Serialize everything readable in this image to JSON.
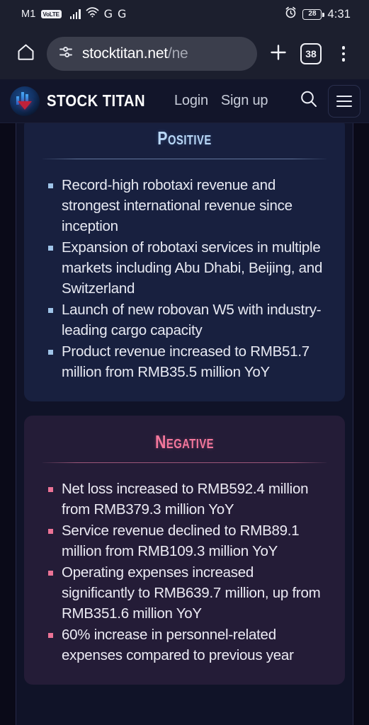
{
  "status_bar": {
    "carrier": "M1",
    "volte_badge": "VoLTE",
    "network_badges": [
      "G",
      "G"
    ],
    "battery_percent": "28",
    "time": "4:31"
  },
  "browser": {
    "home_icon": "home-icon",
    "url_main": "stocktitan.net",
    "url_truncated": "/ne",
    "site_settings_icon": "tune-icon",
    "new_tab_label": "+",
    "tab_count": "38",
    "menu_icon": "kebab-menu-icon"
  },
  "site_header": {
    "brand_name": "STOCK TITAN",
    "logo_icon": "stock-titan-logo",
    "nav": [
      {
        "label": "Login"
      },
      {
        "label": "Sign up"
      }
    ],
    "search_icon": "search-icon",
    "menu_icon": "hamburger-icon"
  },
  "main": {
    "cards": [
      {
        "id": "positive",
        "title": "Positive",
        "accent": "#b9d8f7",
        "bullet_color": "#9fc4e8",
        "background": "#18203f",
        "items": [
          "Record-high robotaxi revenue and strongest international revenue since inception",
          "Expansion of robotaxi services in multiple markets including Abu Dhabi, Beijing, and Switzerland",
          "Launch of new robovan W5 with industry-leading cargo capacity",
          "Product revenue increased to RMB51.7 million from RMB35.5 million YoY"
        ]
      },
      {
        "id": "negative",
        "title": "Negative",
        "accent": "#f4779c",
        "bullet_color": "#ec7396",
        "background": "#241c37",
        "items": [
          "Net loss increased to RMB592.4 million from RMB379.3 million YoY",
          "Service revenue declined to RMB89.1 million from RMB109.3 million YoY",
          "Operating expenses increased significantly to RMB639.7 million, up from RMB351.6 million YoY",
          "60% increase in personnel-related expenses compared to previous year"
        ]
      }
    ]
  }
}
